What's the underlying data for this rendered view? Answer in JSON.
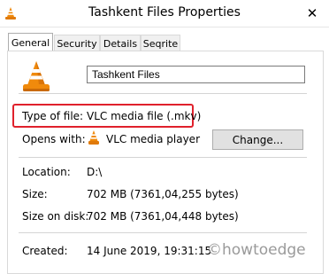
{
  "window": {
    "title": "Tashkent Files Properties",
    "close_glyph": "✕"
  },
  "tabs": [
    {
      "label": "General",
      "active": true
    },
    {
      "label": "Security",
      "active": false
    },
    {
      "label": "Details",
      "active": false
    },
    {
      "label": "Seqrite",
      "active": false
    }
  ],
  "general": {
    "file_name": "Tashkent Files",
    "type_of_file_label": "Type of file:",
    "type_of_file_value": "VLC media file (.mkv)",
    "opens_with_label": "Opens with:",
    "opens_with_value": "VLC media player",
    "change_button": "Change...",
    "location_label": "Location:",
    "location_value": "D:\\",
    "size_label": "Size:",
    "size_value": "702 MB (7361,04,255 bytes)",
    "size_on_disk_label": "Size on disk:",
    "size_on_disk_value": "702 MB (7361,04,448 bytes)",
    "created_label": "Created:",
    "created_value": "14 June 2019, 19:31:15"
  },
  "watermark": "©howtoedge",
  "colors": {
    "highlight_border": "#e0212c",
    "vlc_orange": "#f08a0c"
  },
  "icons": [
    "vlc-cone-icon",
    "close-icon"
  ]
}
